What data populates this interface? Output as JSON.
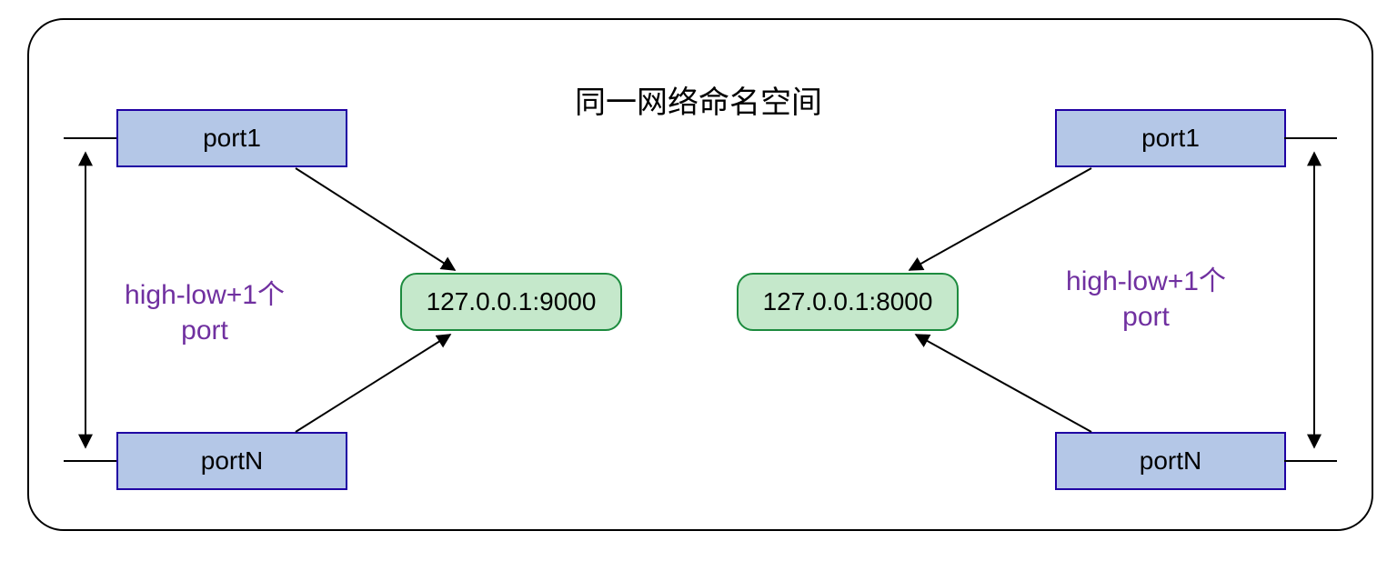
{
  "title": "同一网络命名空间",
  "left": {
    "port_top": "port1",
    "port_bottom": "portN",
    "ip": "127.0.0.1:9000",
    "count_label_top": "high-low+1个",
    "count_label_bottom": "port"
  },
  "right": {
    "port_top": "port1",
    "port_bottom": "portN",
    "ip": "127.0.0.1:8000",
    "count_label_top": "high-low+1个",
    "count_label_bottom": "port"
  }
}
